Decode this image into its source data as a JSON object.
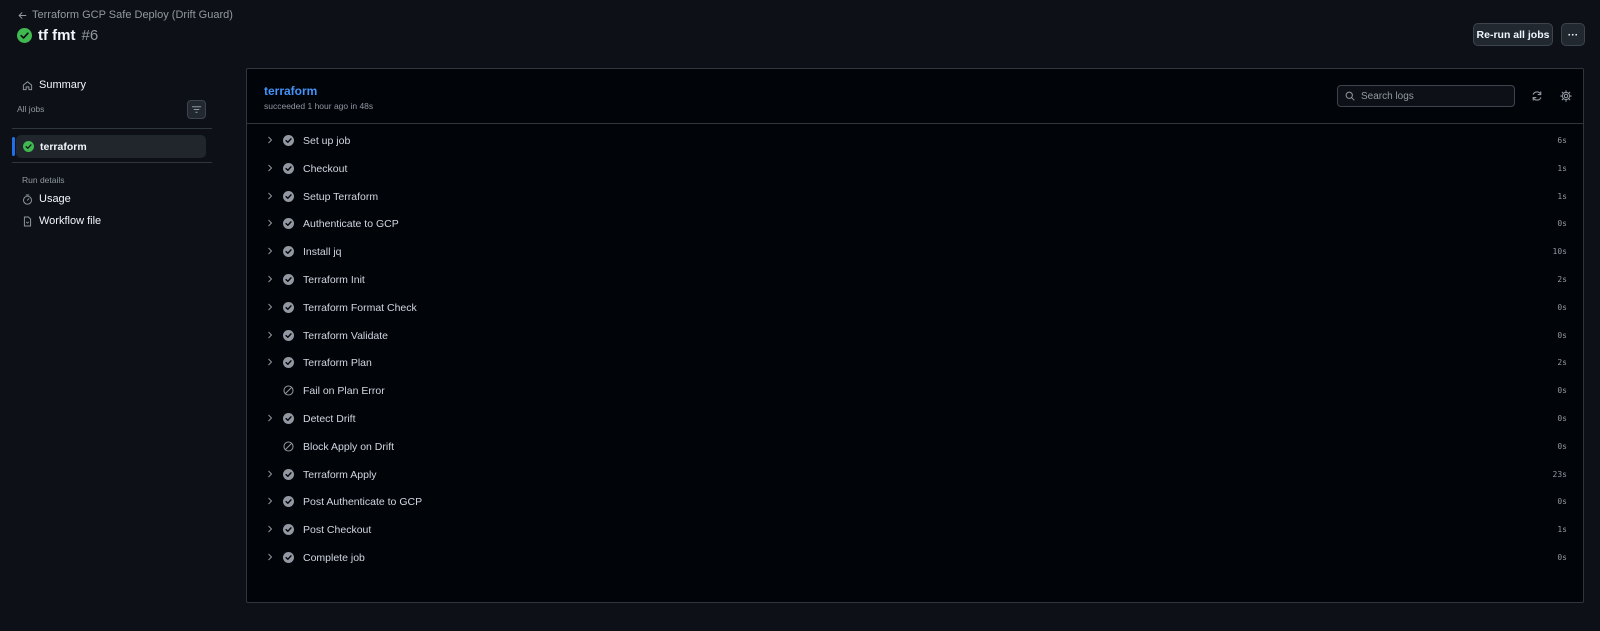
{
  "header": {
    "back_label": "Terraform GCP Safe Deploy (Drift Guard)",
    "run_name": "tf fmt",
    "run_number": "#6",
    "rerun_label": "Re-run all jobs",
    "more_label": "···"
  },
  "sidebar": {
    "summary_label": "Summary",
    "all_jobs_label": "All jobs",
    "job_label": "terraform",
    "run_details_label": "Run details",
    "usage_label": "Usage",
    "workflow_file_label": "Workflow file"
  },
  "job": {
    "name": "terraform",
    "meta": "succeeded 1 hour ago in 48s",
    "search_placeholder": "Search logs"
  },
  "steps": [
    {
      "label": "Set up job",
      "duration": "6s",
      "status": "success",
      "expandable": true
    },
    {
      "label": "Checkout",
      "duration": "1s",
      "status": "success",
      "expandable": true
    },
    {
      "label": "Setup Terraform",
      "duration": "1s",
      "status": "success",
      "expandable": true
    },
    {
      "label": "Authenticate to GCP",
      "duration": "0s",
      "status": "success",
      "expandable": true
    },
    {
      "label": "Install jq",
      "duration": "10s",
      "status": "success",
      "expandable": true
    },
    {
      "label": "Terraform Init",
      "duration": "2s",
      "status": "success",
      "expandable": true
    },
    {
      "label": "Terraform Format Check",
      "duration": "0s",
      "status": "success",
      "expandable": true
    },
    {
      "label": "Terraform Validate",
      "duration": "0s",
      "status": "success",
      "expandable": true
    },
    {
      "label": "Terraform Plan",
      "duration": "2s",
      "status": "success",
      "expandable": true
    },
    {
      "label": "Fail on Plan Error",
      "duration": "0s",
      "status": "skipped",
      "expandable": false
    },
    {
      "label": "Detect Drift",
      "duration": "0s",
      "status": "success",
      "expandable": true
    },
    {
      "label": "Block Apply on Drift",
      "duration": "0s",
      "status": "skipped",
      "expandable": false
    },
    {
      "label": "Terraform Apply",
      "duration": "23s",
      "status": "success",
      "expandable": true
    },
    {
      "label": "Post Authenticate to GCP",
      "duration": "0s",
      "status": "success",
      "expandable": true
    },
    {
      "label": "Post Checkout",
      "duration": "1s",
      "status": "success",
      "expandable": true
    },
    {
      "label": "Complete job",
      "duration": "0s",
      "status": "success",
      "expandable": true
    }
  ],
  "colors": {
    "success": "#3fb950",
    "step_icon": "#9198a1",
    "accent": "#1f6feb",
    "link": "#4493f8"
  },
  "icons": {
    "back": "arrow-left-icon",
    "run_status": "check-circle-icon",
    "summary": "home-icon",
    "filter": "filter-icon",
    "usage": "stopwatch-icon",
    "workflow_file": "file-icon",
    "search": "search-icon",
    "refresh": "refresh-icon",
    "settings": "gear-icon"
  }
}
